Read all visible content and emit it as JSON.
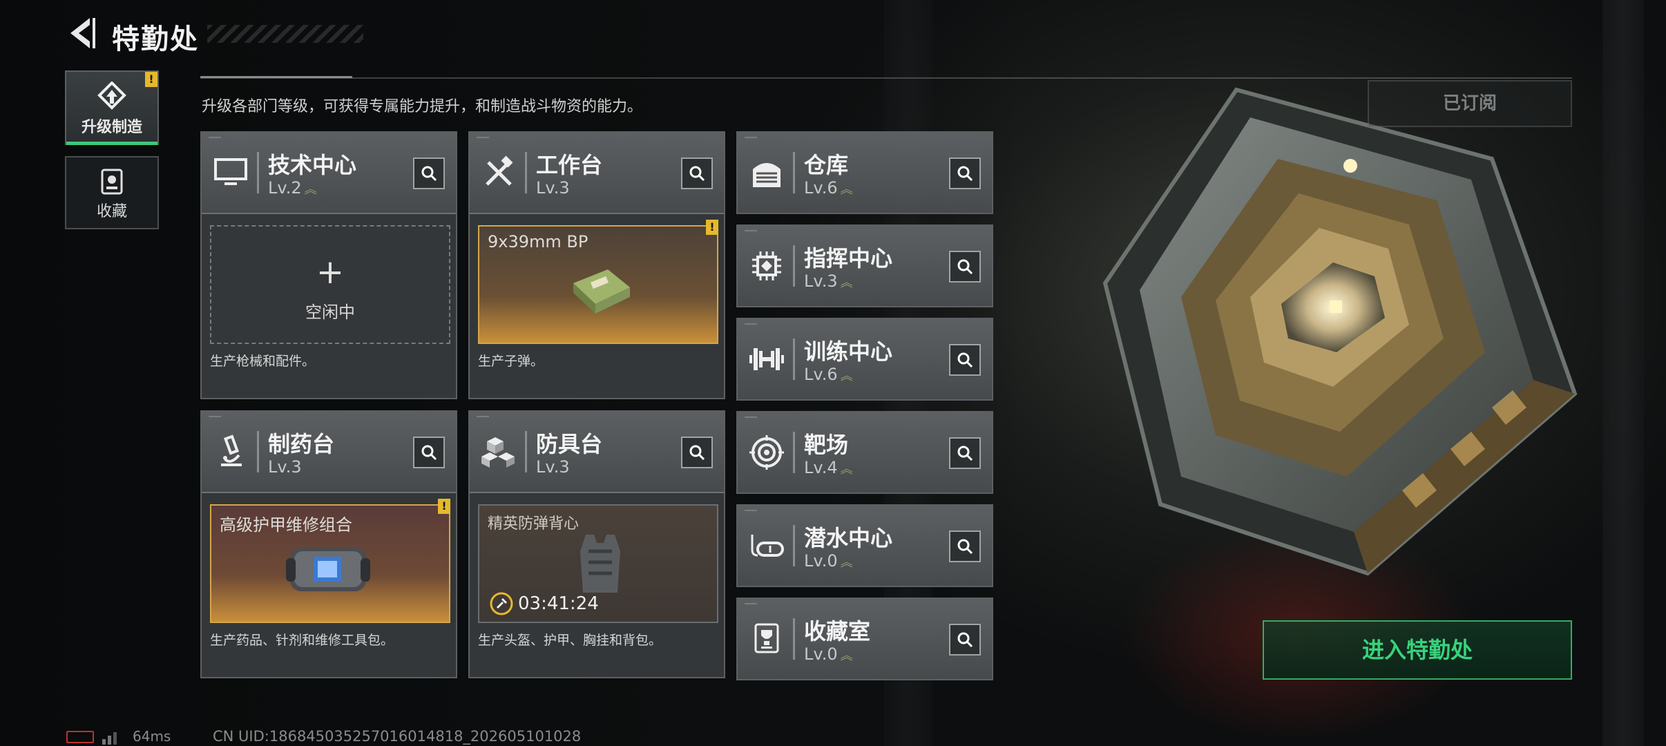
{
  "header": {
    "title": "特勤处"
  },
  "sidebar": {
    "items": [
      {
        "label": "升级制造",
        "active": true,
        "warn": "!"
      },
      {
        "label": "收藏",
        "active": false
      }
    ]
  },
  "description": "升级各部门等级，可获得专属能力提升，和制造战斗物资的能力。",
  "subscribed_label": "已订阅",
  "facilities_production": [
    {
      "name": "技术中心",
      "level": "Lv.2",
      "slot_type": "empty",
      "slot_plus": "+",
      "slot_text": "空闲中",
      "desc": "生产枪械和配件。",
      "upgradeable": true
    },
    {
      "name": "工作台",
      "level": "Lv.3",
      "slot_type": "produced",
      "slot_text": "9x39mm BP",
      "warn": "!",
      "desc": "生产子弹。",
      "upgradeable": false
    },
    {
      "name": "制药台",
      "level": "Lv.3",
      "slot_type": "produced",
      "slot_text": "高级护甲维修组合",
      "warn": "!",
      "desc": "生产药品、针剂和维修工具包。",
      "upgradeable": false
    },
    {
      "name": "防具台",
      "level": "Lv.3",
      "slot_type": "timer",
      "slot_text": "精英防弹背心",
      "timer": "03:41:24",
      "desc": "生产头盔、护甲、胸挂和背包。",
      "upgradeable": false
    }
  ],
  "facilities_other": [
    {
      "name": "仓库",
      "level": "Lv.6",
      "icon": "warehouse-icon",
      "upgradeable": true
    },
    {
      "name": "指挥中心",
      "level": "Lv.3",
      "icon": "chip-icon",
      "upgradeable": true
    },
    {
      "name": "训练中心",
      "level": "Lv.6",
      "icon": "dumbbell-icon",
      "upgradeable": true
    },
    {
      "name": "靶场",
      "level": "Lv.4",
      "icon": "target-icon",
      "upgradeable": true
    },
    {
      "name": "潜水中心",
      "level": "Lv.0",
      "icon": "diving-mask-icon",
      "upgradeable": true
    },
    {
      "name": "收藏室",
      "level": "Lv.0",
      "icon": "trophy-icon",
      "upgradeable": true
    }
  ],
  "enter_button": "进入特勤处",
  "status": {
    "ping": "64ms",
    "uid": "CN UID:186845035257016014818_202605101028"
  },
  "colors": {
    "accent": "#3cc97a",
    "warning": "#e6b92b",
    "gold": "#d6a64a"
  }
}
